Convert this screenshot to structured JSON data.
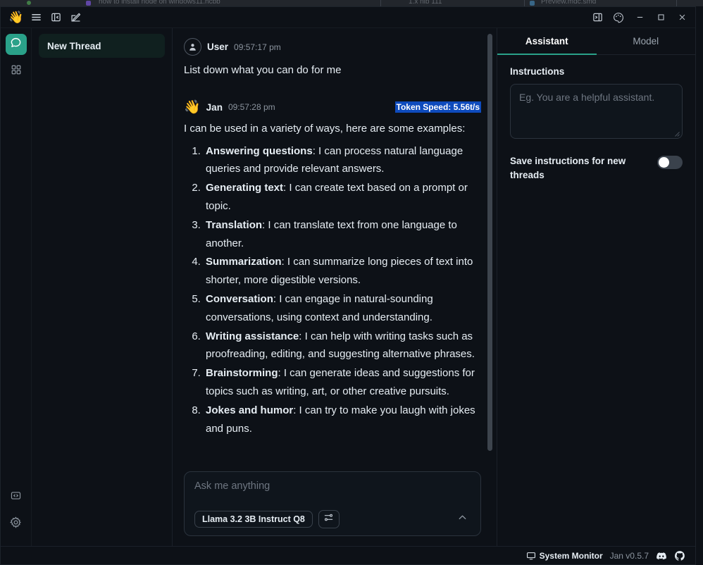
{
  "behind_window": {
    "tabs": [
      {
        "label": "how to install node on windows11.hcbb"
      },
      {
        "label": "1.x  nib  111"
      },
      {
        "label": "Preview.mdc.smd"
      }
    ]
  },
  "titlebar": {
    "logo_icon": "wave-hand-logo",
    "menu_icon": "hamburger-menu-icon",
    "toggle_left_panel_icon": "toggle-left-panel-icon",
    "new_thread_icon": "compose-new-thread-icon",
    "toggle_right_panel_icon": "toggle-right-panel-icon",
    "theme_icon": "palette-theme-icon",
    "minimize_icon": "minimize-icon",
    "maximize_icon": "maximize-icon",
    "close_icon": "close-icon"
  },
  "rail": {
    "chat_icon": "chat-bubble-icon",
    "hub_icon": "grid-hub-icon",
    "code_icon": "code-brackets-icon",
    "settings_icon": "gear-settings-icon"
  },
  "threads": {
    "items": [
      {
        "title": "New Thread",
        "active": true
      }
    ]
  },
  "conversation": {
    "messages": [
      {
        "sender": "User",
        "timestamp": "09:57:17 pm",
        "avatar": "user-avatar",
        "text": "List down what you can do for me"
      },
      {
        "sender": "Jan",
        "timestamp": "09:57:28 pm",
        "avatar": "👋",
        "token_speed": "Token Speed: 5.56t/s",
        "intro": "I can be used in a variety of ways, here are some examples:",
        "list": [
          {
            "term": "Answering questions",
            "desc": ": I can process natural language queries and provide relevant answers."
          },
          {
            "term": "Generating text",
            "desc": ": I can create text based on a prompt or topic."
          },
          {
            "term": "Translation",
            "desc": ": I can translate text from one language to another."
          },
          {
            "term": "Summarization",
            "desc": ": I can summarize long pieces of text into shorter, more digestible versions."
          },
          {
            "term": "Conversation",
            "desc": ": I can engage in natural-sounding conversations, using context and understanding."
          },
          {
            "term": "Writing assistance",
            "desc": ": I can help with writing tasks such as proofreading, editing, and suggesting alternative phrases."
          },
          {
            "term": "Brainstorming",
            "desc": ": I can generate ideas and suggestions for topics such as writing, art, or other creative pursuits."
          },
          {
            "term": "Jokes and humor",
            "desc": ": I can try to make you laugh with jokes and puns."
          }
        ]
      }
    ]
  },
  "composer": {
    "placeholder": "Ask me anything",
    "model_label": "Llama 3.2 3B Instruct Q8",
    "settings_icon": "sliders-settings-icon",
    "collapse_icon": "chevron-up-icon"
  },
  "right_panel": {
    "tabs": [
      {
        "label": "Assistant",
        "active": true
      },
      {
        "label": "Model",
        "active": false
      }
    ],
    "instructions_label": "Instructions",
    "instructions_value": "",
    "instructions_placeholder": "Eg. You are a helpful assistant.",
    "save_toggle_label": "Save instructions for new threads",
    "save_toggle_on": false
  },
  "statusbar": {
    "monitor_icon": "monitor-screen-icon",
    "monitor_label": "System Monitor",
    "version": "Jan v0.5.7",
    "discord_icon": "discord-icon",
    "github_icon": "github-icon"
  },
  "colors": {
    "accent_teal": "#2aa189",
    "selection_blue": "#0e4bbd",
    "bg": "#0d1117",
    "text": "#e6edf3",
    "muted": "#8b949e"
  }
}
